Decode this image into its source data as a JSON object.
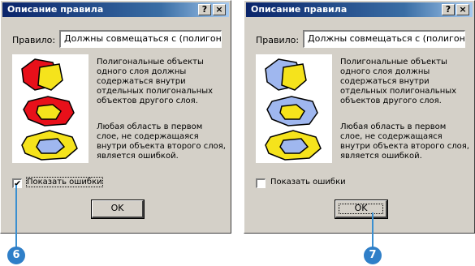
{
  "left_dialog": {
    "title": "Описание правила",
    "help_glyph": "?",
    "close_glyph": "×",
    "rule_label": "Правило:",
    "rule_value": "Должны совмещаться с (полигон,по",
    "description_1": "Полигональные объекты одного слоя должны содержаться внутри отдельных полигональных объектов другого слоя.",
    "description_2": "Любая область в первом слое, не содержащаяся внутри объекта второго слоя, является ошибкой.",
    "show_errors_label": "Показать ошибки",
    "show_errors_checked": true,
    "check_mark": "✔",
    "ok_label": "OK",
    "shape_colors": {
      "outer": "#e8101a",
      "inner": "#f5e31c"
    }
  },
  "right_dialog": {
    "title": "Описание правила",
    "help_glyph": "?",
    "close_glyph": "×",
    "rule_label": "Правило:",
    "rule_value": "Должны совмещаться с (полигон,по",
    "description_1": "Полигональные объекты одного слоя должны содержаться внутри отдельных полигональных объектов другого слоя.",
    "description_2": "Любая область в первом слое, не содержащаяся внутри объекта второго слоя, является ошибкой.",
    "show_errors_label": "Показать ошибки",
    "show_errors_checked": false,
    "check_mark": "",
    "ok_label": "OK",
    "shape_colors": {
      "outer": "#9fb7ef",
      "inner": "#f5e31c"
    }
  },
  "callouts": {
    "left": "6",
    "right": "7",
    "color": "#2f7fc8"
  }
}
